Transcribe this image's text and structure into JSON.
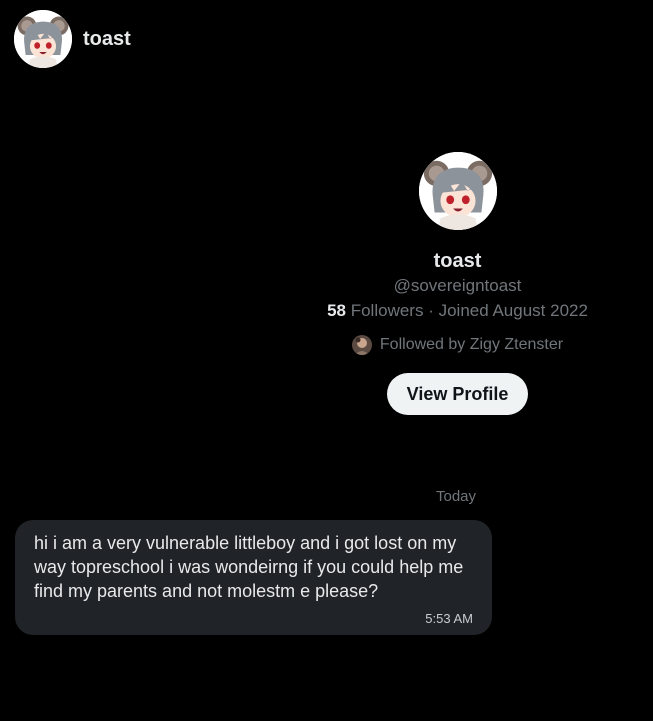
{
  "header": {
    "name": "toast",
    "avatar_icon": "anime-mouse-girl-avatar-icon"
  },
  "profile": {
    "name": "toast",
    "handle": "@sovereigntoast",
    "followers_count": "58",
    "followers_label": "Followers",
    "joined": "· Joined August 2022",
    "followed_by": "Followed by Zigy Ztenster",
    "view_profile_label": "View Profile"
  },
  "conversation": {
    "day_separator": "Today",
    "messages": [
      {
        "text": "hi i am a very vulnerable littleboy and i got lost on my way topreschool i was wondeirng if you could help me find my parents and not molestm e please?",
        "time": "5:53 AM"
      }
    ]
  },
  "colors": {
    "background": "#000000",
    "text_primary": "#e7e9ea",
    "text_secondary": "#71767b",
    "bubble": "#202327",
    "button_bg": "#eff3f4",
    "button_text": "#0f1419"
  }
}
